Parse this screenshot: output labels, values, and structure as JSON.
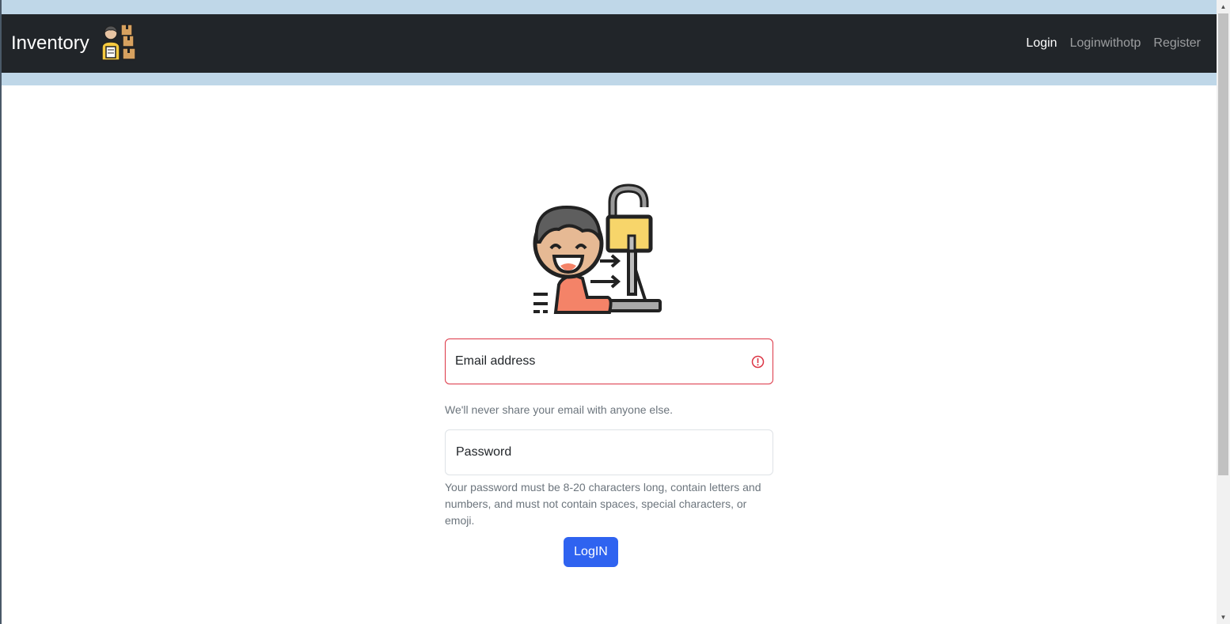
{
  "navbar": {
    "brand": "Inventory",
    "brand_icon": "warehouse-worker-boxes-icon",
    "links": [
      {
        "label": "Login",
        "active": true
      },
      {
        "label": "Loginwithotp",
        "active": false
      },
      {
        "label": "Register",
        "active": false
      }
    ]
  },
  "hero": {
    "icon": "unlock-login-user-icon"
  },
  "form": {
    "email": {
      "label": "Email address",
      "value": "",
      "invalid": true
    },
    "email_help": "We'll never share your email with anyone else.",
    "password": {
      "label": "Password",
      "value": ""
    },
    "password_help": "Your password must be 8-20 characters long, contain letters and numbers, and must not contain spaces, special characters, or emoji.",
    "submit_label": "LogIN"
  },
  "colors": {
    "navbar_bg": "#212529",
    "top_band": "#bfd7e8",
    "primary": "#2f63f0",
    "invalid": "#dc3545"
  }
}
